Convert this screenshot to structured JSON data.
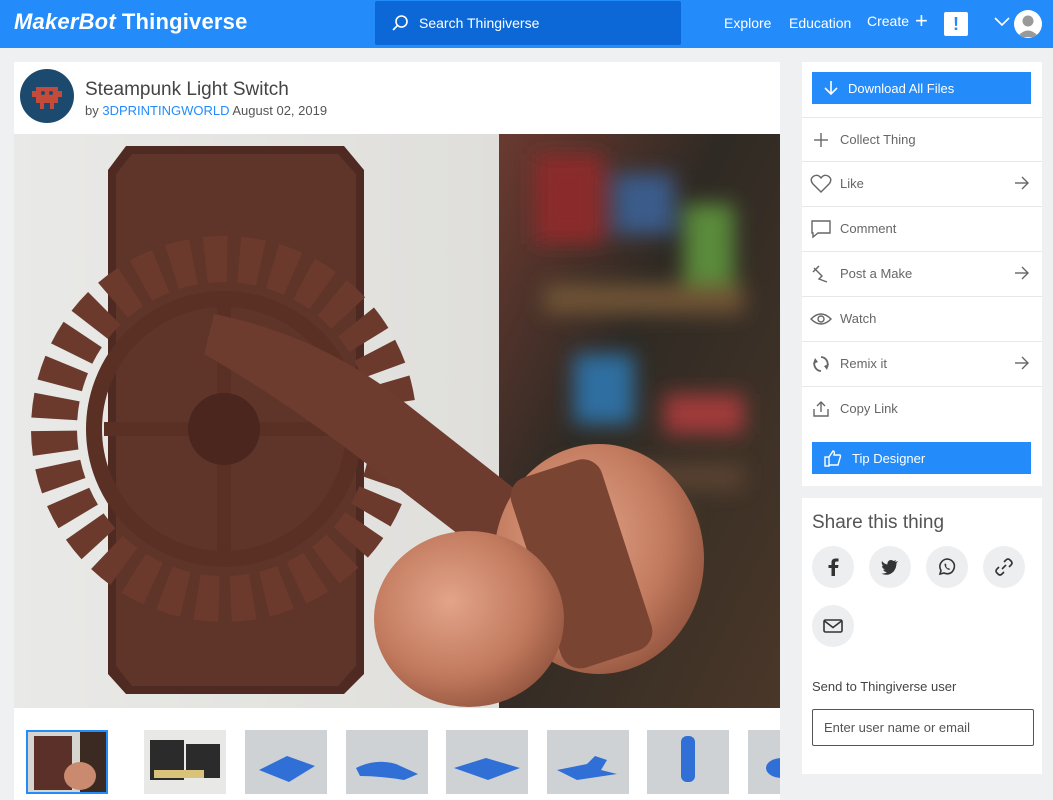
{
  "nav": {
    "logo_brand": "MakerBot",
    "logo_product": "Thingiverse",
    "search_placeholder": "Search Thingiverse",
    "explore": "Explore",
    "education": "Education",
    "create": "Create",
    "alert": "!"
  },
  "thing": {
    "title": "Steampunk Light Switch",
    "by": "by",
    "author": "3DPRINTINGWORLD",
    "date": "August 02, 2019"
  },
  "actions": {
    "download": "Download All Files",
    "collect": "Collect Thing",
    "like": "Like",
    "comment": "Comment",
    "post_make": "Post a Make",
    "watch": "Watch",
    "remix": "Remix it",
    "copy_link": "Copy Link",
    "tip": "Tip Designer"
  },
  "share": {
    "title": "Share this thing",
    "send_label": "Send to Thingiverse user",
    "send_placeholder": "Enter user name or email"
  },
  "colors": {
    "brand_blue": "#248bfb",
    "search_bg": "#0c68d6"
  }
}
